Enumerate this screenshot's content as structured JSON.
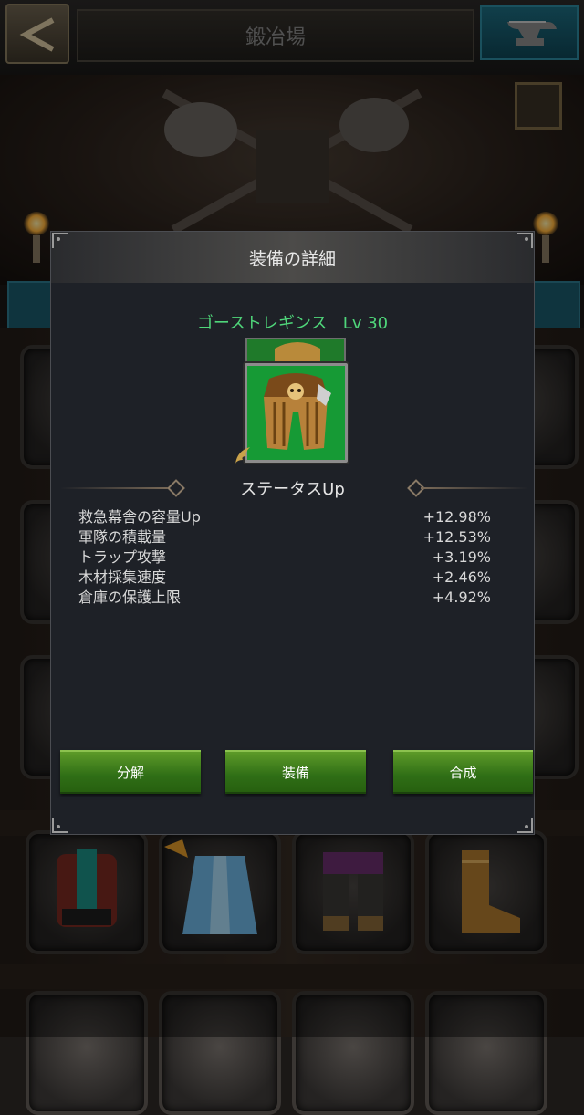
{
  "header": {
    "title": "鍛冶場",
    "back_icon": "chevron-left-icon",
    "forge_icon": "anvil-icon"
  },
  "modal": {
    "title": "装備の詳細",
    "item": {
      "name": "ゴーストレギンス",
      "level": "Lv 30",
      "name_color": "#4fd67a",
      "icon": "leggings-icon",
      "frame_color": "#169a35"
    },
    "section_title": "ステータスUp",
    "stats": [
      {
        "label": "救急幕舎の容量Up",
        "value": "+12.98%"
      },
      {
        "label": "軍隊の積載量",
        "value": "+12.53%"
      },
      {
        "label": "トラップ攻撃",
        "value": "+3.19%"
      },
      {
        "label": "木材採集速度",
        "value": "+2.46%"
      },
      {
        "label": "倉庫の保護上限",
        "value": "+4.92%"
      }
    ],
    "buttons": {
      "dismantle": "分解",
      "equip": "装備",
      "compose": "合成"
    }
  },
  "inventory": {
    "visible_items": [
      "chest-armor-icon",
      "cape-icon",
      "leggings-icon",
      "boots-icon"
    ]
  }
}
